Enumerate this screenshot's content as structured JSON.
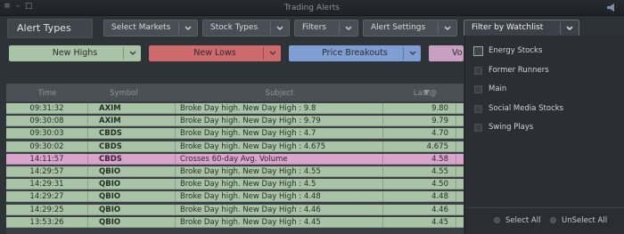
{
  "window": {
    "title": "Trading Alerts",
    "controls": [
      "≡",
      "–",
      "□"
    ]
  },
  "toolbar": {
    "title": "Alert Types",
    "select_markets": "Select Markets",
    "stock_types": "Stock Types",
    "filters": "Filters",
    "alert_settings": "Alert Settings",
    "filter_by_watchlist": "Filter by Watchlist"
  },
  "quick_filters": [
    {
      "label": "New Highs",
      "color": "#a9c3a6"
    },
    {
      "label": "New Lows",
      "color": "#cf6a6c"
    },
    {
      "label": "Price Breakouts",
      "color": "#7f9fd4"
    },
    {
      "label": "Vo",
      "color": "#c9a0c3"
    }
  ],
  "table": {
    "columns": {
      "time": "Time",
      "symbol": "Symbol",
      "subject": "Subject",
      "last": "Last@"
    },
    "rows": [
      {
        "time": "09:31:32",
        "symbol": "AXIM",
        "subject": "Broke Day high. New Day High : 9.8",
        "last": "9.80",
        "type": "green"
      },
      {
        "time": "09:30:08",
        "symbol": "AXIM",
        "subject": "Broke Day high. New Day High : 9.79",
        "last": "9.79",
        "type": "green"
      },
      {
        "time": "09:30:03",
        "symbol": "CBDS",
        "subject": "Broke Day high. New Day High : 4.7",
        "last": "4.70",
        "type": "green"
      },
      {
        "time": "09:30:02",
        "symbol": "CBDS",
        "subject": "Broke Day high. New Day High : 4.675",
        "last": "4.675",
        "type": "green"
      },
      {
        "time": "14:11:57",
        "symbol": "CBDS",
        "subject": "Crosses 60-day Avg. Volume",
        "last": "4.58",
        "type": "purple"
      },
      {
        "time": "14:29:57",
        "symbol": "QBIO",
        "subject": "Broke Day high. New Day High : 4.55",
        "last": "4.55",
        "type": "green"
      },
      {
        "time": "14:29:31",
        "symbol": "QBIO",
        "subject": "Broke Day high. New Day High : 4.5",
        "last": "4.50",
        "type": "green"
      },
      {
        "time": "14:29:27",
        "symbol": "QBIO",
        "subject": "Broke Day high. New Day High : 4.48",
        "last": "4.48",
        "type": "green"
      },
      {
        "time": "14:29:25",
        "symbol": "QBIO",
        "subject": "Broke Day high. New Day High : 4.46",
        "last": "4.46",
        "type": "green"
      },
      {
        "time": "13:53:26",
        "symbol": "QBIO",
        "subject": "Broke Day high. New Day High : 4.45",
        "last": "4.45",
        "type": "green"
      }
    ]
  },
  "watchlist_panel": {
    "items": [
      {
        "label": "Energy Stocks",
        "active": true
      },
      {
        "label": "Former Runners",
        "active": false
      },
      {
        "label": "Main",
        "active": false
      },
      {
        "label": "Social Media Stocks",
        "active": false
      },
      {
        "label": "Swing Plays",
        "active": false
      }
    ],
    "select_all": "Select All",
    "unselect_all": "UnSelect All"
  }
}
